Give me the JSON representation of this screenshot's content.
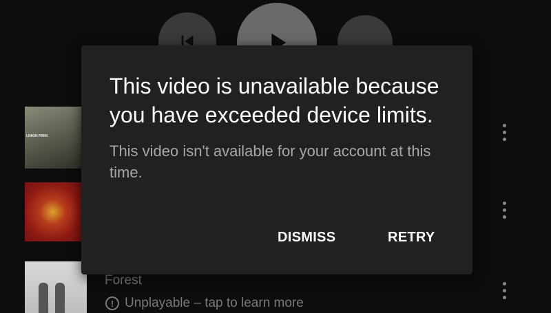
{
  "dialog": {
    "title": "This video is unavailable because you have exceeded device limits.",
    "message": "This video isn't available for your account at this time.",
    "dismiss_label": "DISMISS",
    "retry_label": "RETRY"
  },
  "playlist": {
    "items": [
      {
        "thumb_caption": "LINKIN PARK"
      },
      {},
      {
        "title": "Forest",
        "status": "Unplayable – tap to learn more",
        "status_icon": "info-icon"
      }
    ]
  },
  "colors": {
    "dialog_bg": "#212121",
    "title_text": "#ffffff",
    "body_text": "#a8a8a8",
    "background": "#0d0d0d"
  }
}
